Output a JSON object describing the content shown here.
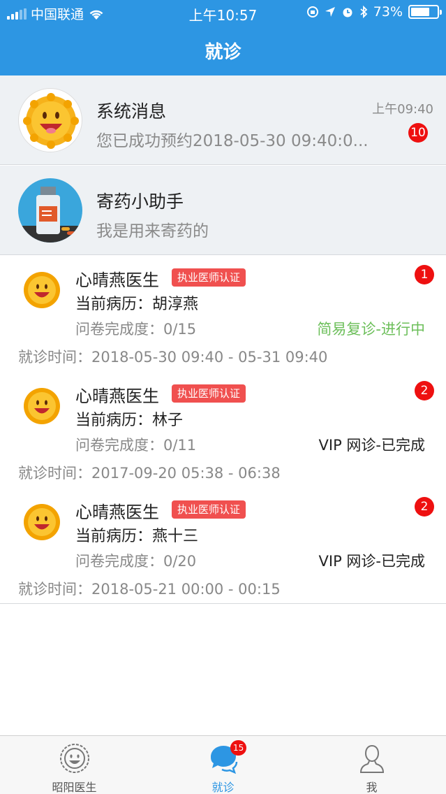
{
  "status_bar": {
    "carrier": "中国联通",
    "time": "上午10:57",
    "battery": "73%",
    "battery_level": 0.73
  },
  "header": {
    "title": "就诊"
  },
  "messages": [
    {
      "title": "系统消息",
      "subtitle": "您已成功预约2018-05-30 09:40:0...",
      "time": "上午09:40",
      "badge": "10",
      "avatar_icon": "sun-mascot-icon"
    },
    {
      "title": "寄药小助手",
      "subtitle": "我是用来寄药的",
      "avatar_icon": "medicine-bottle-icon"
    }
  ],
  "visits": [
    {
      "doctor": "心晴燕医生",
      "cert": "执业医师认证",
      "record": "当前病历：胡淳燕",
      "survey": "问卷完成度：0/15",
      "status": "简易复诊-进行中",
      "status_color": "#6cbf5a",
      "time": "就诊时间：2018-05-30 09:40 - 05-31 09:40",
      "badge": "1"
    },
    {
      "doctor": "心晴燕医生",
      "cert": "执业医师认证",
      "record": "当前病历：林子",
      "survey": "问卷完成度：0/11",
      "status": "VIP 网诊-已完成",
      "status_color": "#222222",
      "time": "就诊时间：2017-09-20 05:38 - 06:38",
      "badge": "2"
    },
    {
      "doctor": "心晴燕医生",
      "cert": "执业医师认证",
      "record": "当前病历：燕十三",
      "survey": "问卷完成度：0/20",
      "status": "VIP 网诊-已完成",
      "status_color": "#222222",
      "time": "就诊时间：2018-05-21 00:00 - 00:15",
      "badge": "2"
    }
  ],
  "tabbar": {
    "tabs": [
      {
        "label": "昭阳医生",
        "icon": "sun-face-icon"
      },
      {
        "label": "就诊",
        "icon": "chat-bubbles-icon",
        "badge": "15",
        "active": true
      },
      {
        "label": "我",
        "icon": "person-icon"
      }
    ]
  },
  "colors": {
    "brand": "#2d96e3",
    "badge": "#ee1010",
    "cert_tag": "#f0504f"
  }
}
